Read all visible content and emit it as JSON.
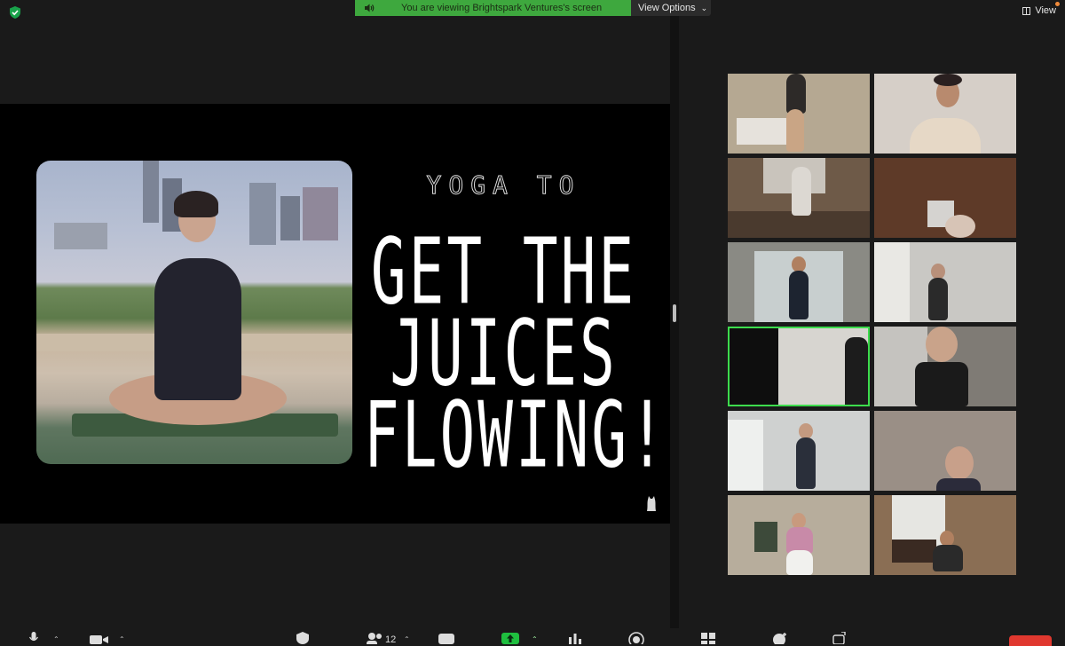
{
  "app": {
    "security_icon": "shield-check-icon"
  },
  "banner": {
    "text": "You are viewing Brightspark Ventures's screen",
    "icon": "speaker-icon"
  },
  "view_options": {
    "label": "View Options"
  },
  "top_right": {
    "label": "View"
  },
  "shared_slide": {
    "line_small": "YOGA TO",
    "line1": "GET THE",
    "line2": "JUICES",
    "line3": "FLOWING!"
  },
  "participants": [
    {
      "bg": "#b5a892",
      "accent": "#7a6a58"
    },
    {
      "bg": "#d6cfc8",
      "accent": "#d8bfa8"
    },
    {
      "bg": "#6e5a48",
      "accent": "#c9c4bc"
    },
    {
      "bg": "#5e3a28",
      "accent": "#d5d3d0"
    },
    {
      "bg": "#8a8a84",
      "accent": "#1d2430"
    },
    {
      "bg": "#c9c8c4",
      "accent": "#2a2a2a"
    },
    {
      "bg": "#d7d5d0",
      "accent": "#1c1c1c"
    },
    {
      "bg": "#7f7b75",
      "accent": "#1a1a1a"
    },
    {
      "bg": "#cfd1d0",
      "accent": "#2a2f3a"
    },
    {
      "bg": "#9a8f86",
      "accent": "#2b2b3a"
    },
    {
      "bg": "#b7ad9c",
      "accent": "#c88aa8"
    },
    {
      "bg": "#8a6e54",
      "accent": "#2a2a2a"
    }
  ],
  "toolbar": {
    "participants_count": "12",
    "icons": [
      "mic-icon",
      "video-icon",
      "security-icon",
      "participants-icon",
      "chat-icon",
      "share-screen-icon",
      "polls-icon",
      "record-icon",
      "apps-icon",
      "reactions-icon",
      "more-icon",
      "end-icon"
    ]
  },
  "colors": {
    "accent_green": "#3ea83e",
    "active_border": "#3ddc4d",
    "share_up": "#1fbf3f",
    "end_red": "#e0382f"
  }
}
